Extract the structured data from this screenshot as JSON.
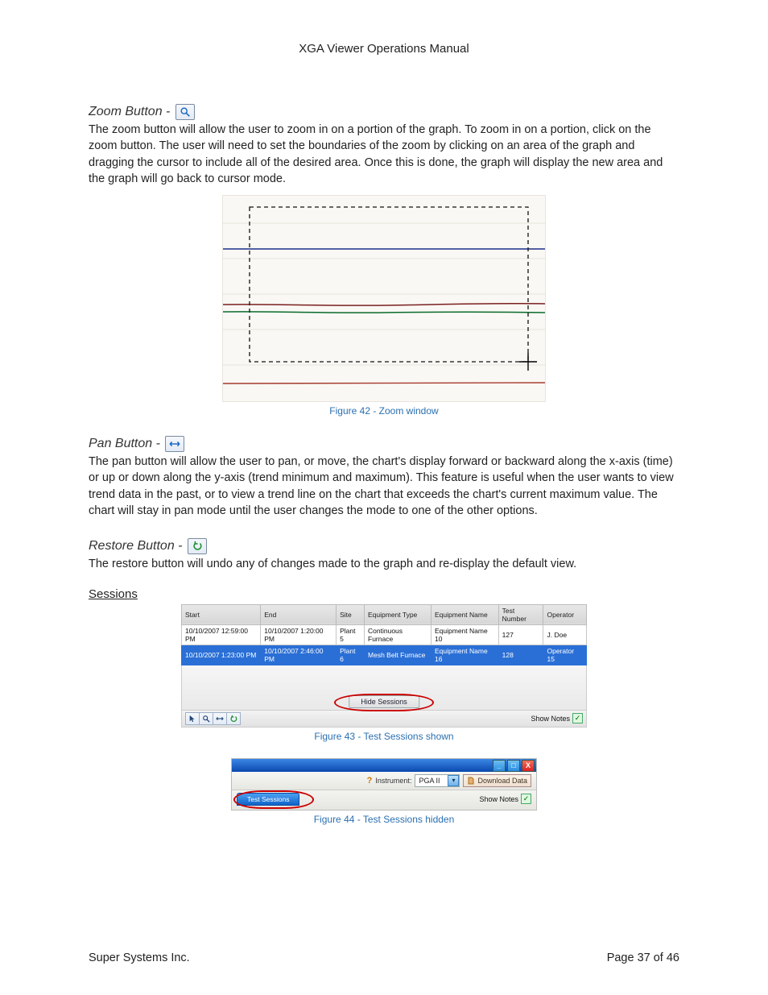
{
  "header": {
    "title": "XGA Viewer Operations Manual"
  },
  "zoom": {
    "title": "Zoom Button -",
    "body": "The zoom button will allow the user to zoom in on a portion of the graph.  To zoom in on a portion, click on the zoom button.  The user will need to set the boundaries of the zoom by clicking on an area of the graph and dragging the cursor to include all of the desired area.  Once this is done, the graph will display the new area and the graph will go back to cursor mode.",
    "caption": "Figure 42 - Zoom window"
  },
  "pan": {
    "title": "Pan Button -",
    "body": "The pan button will allow the user to pan, or move, the chart's display forward or backward along the x-axis (time) or up or down along the y-axis (trend minimum and maximum).  This feature is useful when the user wants to view trend data in the past, or to view a trend line on the chart that exceeds the chart's current maximum value.  The chart will stay in pan mode until the user changes the mode to one of the other options."
  },
  "restore": {
    "title": "Restore Button -",
    "body": "The restore button will undo any of changes made to the graph and re-display the default view."
  },
  "sessions_heading": "Sessions",
  "fig43": {
    "cols": [
      "Start",
      "End",
      "Site",
      "Equipment Type",
      "Equipment Name",
      "Test Number",
      "Operator"
    ],
    "rows": [
      [
        "10/10/2007 12:59:00 PM",
        "10/10/2007 1:20:00 PM",
        "Plant 5",
        "Continuous Furnace",
        "Equipment Name 10",
        "127",
        "J. Doe"
      ],
      [
        "10/10/2007 1:23:00 PM",
        "10/10/2007 2:46:00 PM",
        "Plant 6",
        "Mesh Belt Furnace",
        "Equipment Name 16",
        "128",
        "Operator 15"
      ]
    ],
    "hide_btn": "Hide Sessions",
    "show_notes": "Show Notes",
    "caption": "Figure 43 - Test Sessions shown"
  },
  "fig44": {
    "instrument_label": "Instrument:",
    "instrument_value": "PGA II",
    "download_label": "Download Data",
    "tab_label": "Test Sessions",
    "show_notes": "Show Notes",
    "caption": "Figure 44 - Test Sessions hidden"
  },
  "footer": {
    "left": "Super Systems Inc.",
    "right": "Page 37 of 46"
  }
}
